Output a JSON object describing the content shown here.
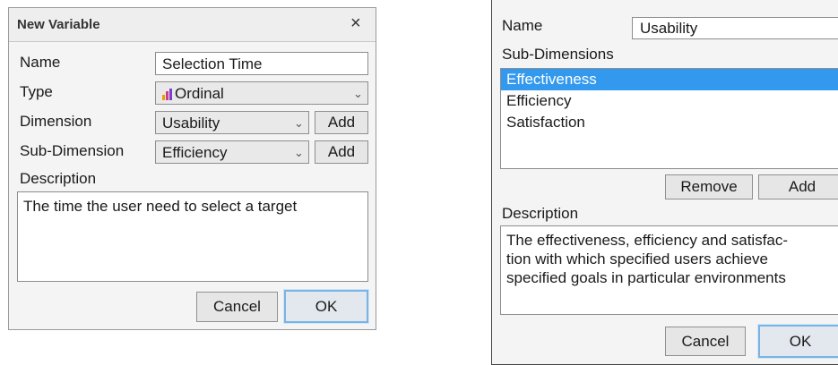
{
  "left_dialog": {
    "title": "New Variable",
    "close_glyph": "×",
    "name_label": "Name",
    "name_value": "Selection Time",
    "type_label": "Type",
    "type_value": "Ordinal",
    "type_icon": "ordinal-chart-icon",
    "dimension_label": "Dimension",
    "dimension_value": "Usability",
    "dimension_add": "Add",
    "subdimension_label": "Sub-Dimension",
    "subdimension_value": "Efficiency",
    "subdimension_add": "Add",
    "description_label": "Description",
    "description_value": "The time the user need to select a target",
    "cancel": "Cancel",
    "ok": "OK"
  },
  "right_dialog": {
    "name_label": "Name",
    "name_value": "Usability",
    "subdimensions_label": "Sub-Dimensions",
    "subdimensions": [
      {
        "label": "Effectiveness",
        "selected": true
      },
      {
        "label": "Efficiency",
        "selected": false
      },
      {
        "label": "Satisfaction",
        "selected": false
      }
    ],
    "remove": "Remove",
    "add": "Add",
    "description_label": "Description",
    "description_lines": [
      "The effectiveness, efficiency and satisfac-",
      "tion with which specified users achieve",
      "specified goals in particular environments"
    ],
    "cancel": "Cancel",
    "ok": "OK"
  },
  "colors": {
    "selection": "#3399ee",
    "ok_border": "#79b4e6",
    "chart_bars": [
      "#e8a000",
      "#d33c8c",
      "#7a3fd1"
    ]
  }
}
